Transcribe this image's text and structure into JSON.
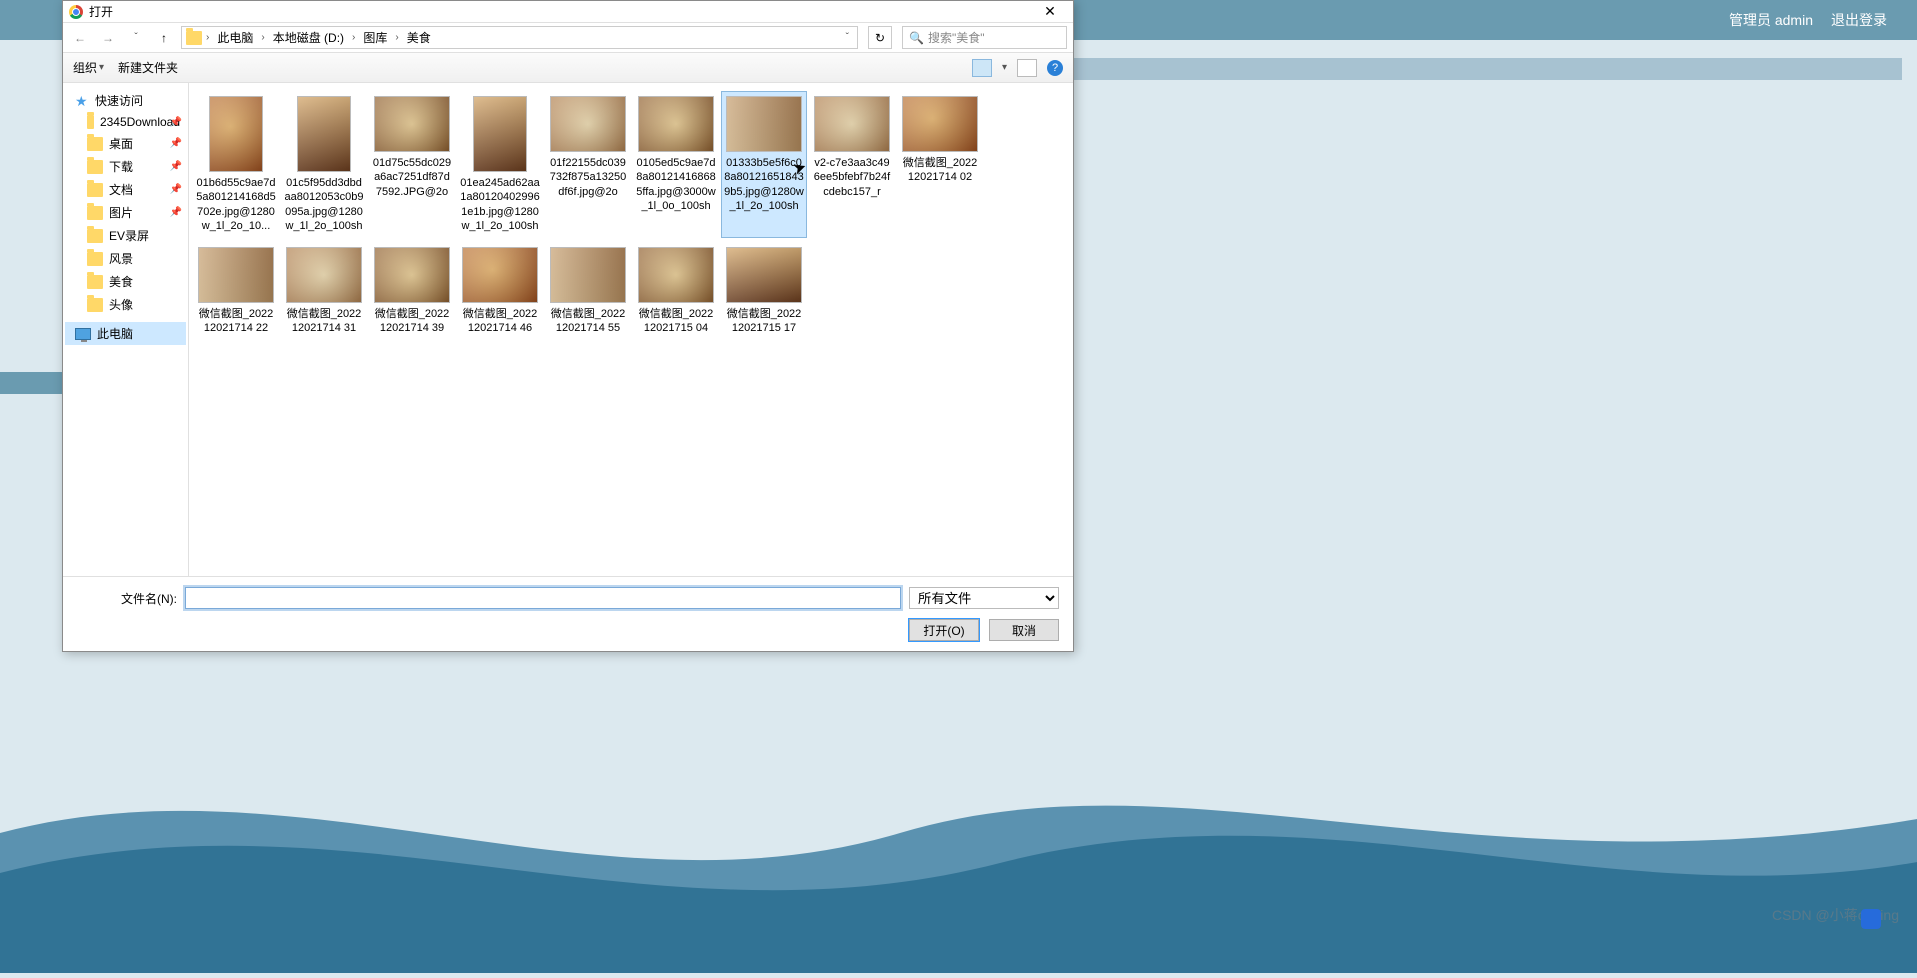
{
  "bg": {
    "admin_label": "管理员 admin",
    "logout_label": "退出登录",
    "watermark": "CSDN @小蒋coding"
  },
  "dialog": {
    "title": "打开",
    "nav": {
      "crumbs": [
        "此电脑",
        "本地磁盘 (D:)",
        "图库",
        "美食"
      ],
      "search_placeholder": "搜索\"美食\""
    },
    "toolbar": {
      "organize": "组织",
      "new_folder": "新建文件夹"
    },
    "sidebar": {
      "quick_access": "快速访问",
      "items": [
        {
          "label": "2345Download",
          "pinned": true,
          "icon": "folder"
        },
        {
          "label": "桌面",
          "pinned": true,
          "icon": "folder"
        },
        {
          "label": "下载",
          "pinned": true,
          "icon": "folder"
        },
        {
          "label": "文档",
          "pinned": true,
          "icon": "folder"
        },
        {
          "label": "图片",
          "pinned": true,
          "icon": "folder"
        },
        {
          "label": "EV录屏",
          "pinned": false,
          "icon": "folder"
        },
        {
          "label": "风景",
          "pinned": false,
          "icon": "folder"
        },
        {
          "label": "美食",
          "pinned": false,
          "icon": "folder"
        },
        {
          "label": "头像",
          "pinned": false,
          "icon": "folder"
        }
      ],
      "this_pc": "此电脑"
    },
    "files": [
      {
        "name": "01b6d55c9ae7d5a801214168d5702e.jpg@1280w_1l_2o_10...",
        "tall": true,
        "t": "food1"
      },
      {
        "name": "01c5f95dd3dbdaa8012053c0b9095a.jpg@1280w_1l_2o_100sh",
        "tall": true,
        "t": "food3"
      },
      {
        "name": "01d75c55dc029a6ac7251df87d7592.JPG@2o",
        "tall": false,
        "t": "food2"
      },
      {
        "name": "01ea245ad62aa1a801204029961e1b.jpg@1280w_1l_2o_100sh",
        "tall": true,
        "t": "food3"
      },
      {
        "name": "01f22155dc039732f875a13250df6f.jpg@2o",
        "tall": false,
        "t": "food4"
      },
      {
        "name": "0105ed5c9ae7d8a801214168685ffa.jpg@3000w_1l_0o_100sh",
        "tall": false,
        "t": "food2"
      },
      {
        "name": "01333b5e5f6c08a801216518439b5.jpg@1280w_1l_2o_100sh",
        "tall": false,
        "t": "food5",
        "selected": true
      },
      {
        "name": "v2-c7e3aa3c496ee5bfebf7b24fcdebc157_r",
        "tall": false,
        "t": "food4"
      },
      {
        "name": "微信截图_202212021714 02",
        "tall": false,
        "t": "food1"
      },
      {
        "name": "微信截图_202212021714 22",
        "tall": false,
        "t": "food5"
      },
      {
        "name": "微信截图_202212021714 31",
        "tall": false,
        "t": "food4"
      },
      {
        "name": "微信截图_202212021714 39",
        "tall": false,
        "t": "food2"
      },
      {
        "name": "微信截图_202212021714 46",
        "tall": false,
        "t": "food1"
      },
      {
        "name": "微信截图_202212021714 55",
        "tall": false,
        "t": "food5"
      },
      {
        "name": "微信截图_202212021715 04",
        "tall": false,
        "t": "food2"
      },
      {
        "name": "微信截图_202212021715 17",
        "tall": false,
        "t": "food3"
      }
    ],
    "footer": {
      "filename_label": "文件名(N):",
      "filename_value": "",
      "filter": "所有文件",
      "open_btn": "打开(O)",
      "cancel_btn": "取消"
    }
  }
}
